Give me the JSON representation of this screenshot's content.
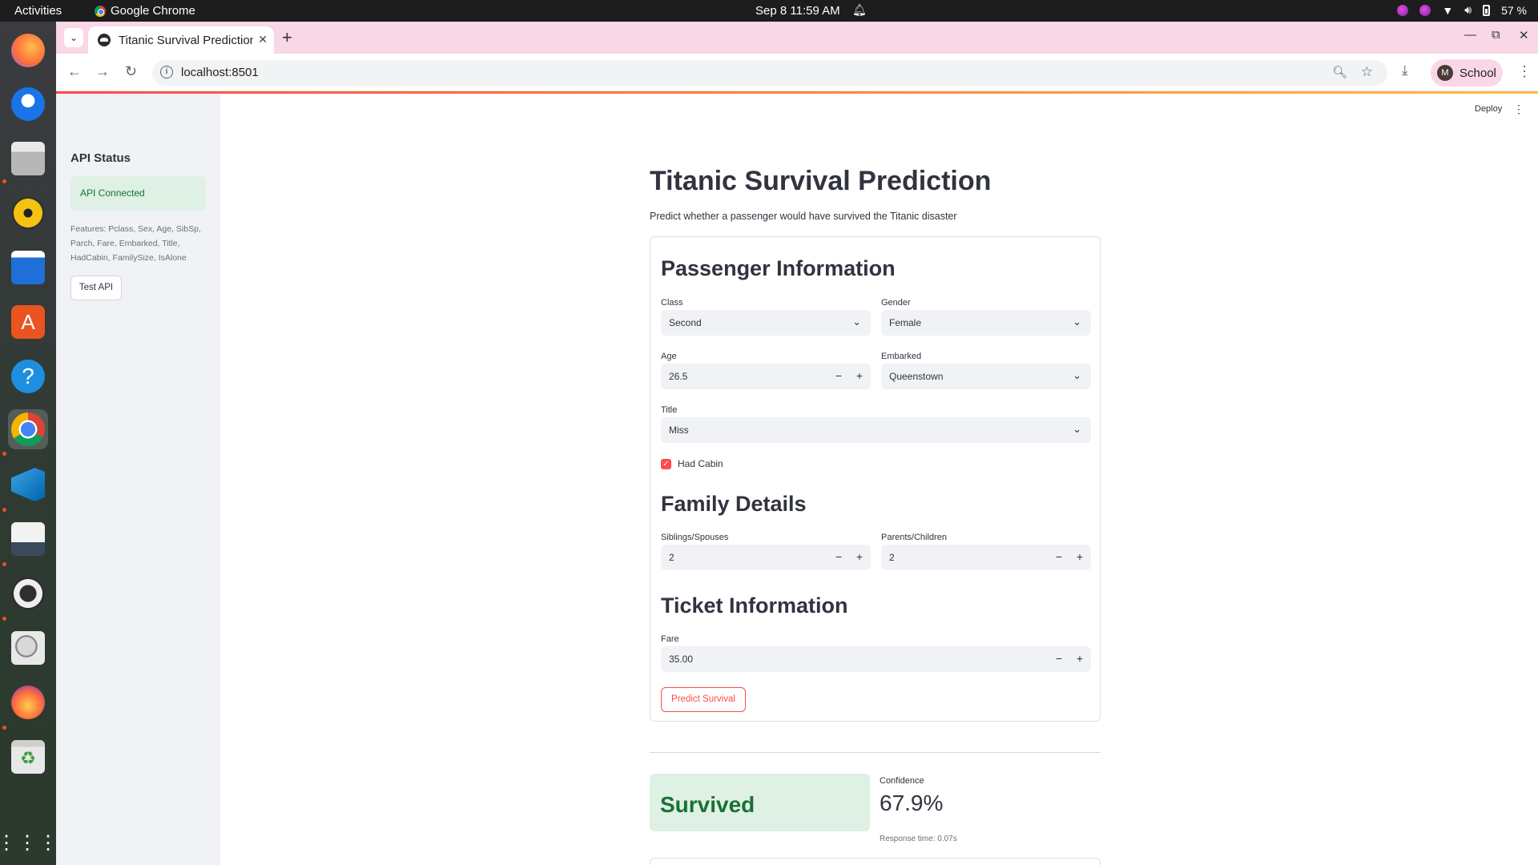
{
  "os": {
    "activities": "Activities",
    "app_name": "Google Chrome",
    "clock": "Sep 8  11:59 AM",
    "battery": "57 %"
  },
  "browser": {
    "tab_title": "Titanic Survival Prediction",
    "url": "localhost:8501",
    "profile_initial": "M",
    "profile_name": "School"
  },
  "sidebar": {
    "title": "API Status",
    "status": "API Connected",
    "features": "Features: Pclass, Sex, Age, SibSp, Parch, Fare, Embarked, Title, HadCabin, FamilySize, IsAlone",
    "test_button": "Test API"
  },
  "header": {
    "deploy": "Deploy"
  },
  "page": {
    "title": "Titanic Survival Prediction",
    "subtitle": "Predict whether a passenger would have survived the Titanic disaster"
  },
  "passenger": {
    "heading": "Passenger Information",
    "class_label": "Class",
    "class_value": "Second",
    "gender_label": "Gender",
    "gender_value": "Female",
    "age_label": "Age",
    "age_value": "26.5",
    "embarked_label": "Embarked",
    "embarked_value": "Queenstown",
    "title_label": "Title",
    "title_value": "Miss",
    "had_cabin_label": "Had Cabin",
    "had_cabin_checked": true
  },
  "family": {
    "heading": "Family Details",
    "siblings_label": "Siblings/Spouses",
    "siblings_value": "2",
    "parents_label": "Parents/Children",
    "parents_value": "2"
  },
  "ticket": {
    "heading": "Ticket Information",
    "fare_label": "Fare",
    "fare_value": "35.00"
  },
  "actions": {
    "predict_button": "Predict Survival"
  },
  "result": {
    "outcome": "Survived",
    "confidence_label": "Confidence",
    "confidence_value": "67.9%",
    "response_time": "Response time: 0.07s"
  },
  "colors": {
    "accent": "#ff4b4b",
    "success_bg": "#dff0e4",
    "success_text": "#177233",
    "tabstrip": "#f9d7e6"
  }
}
